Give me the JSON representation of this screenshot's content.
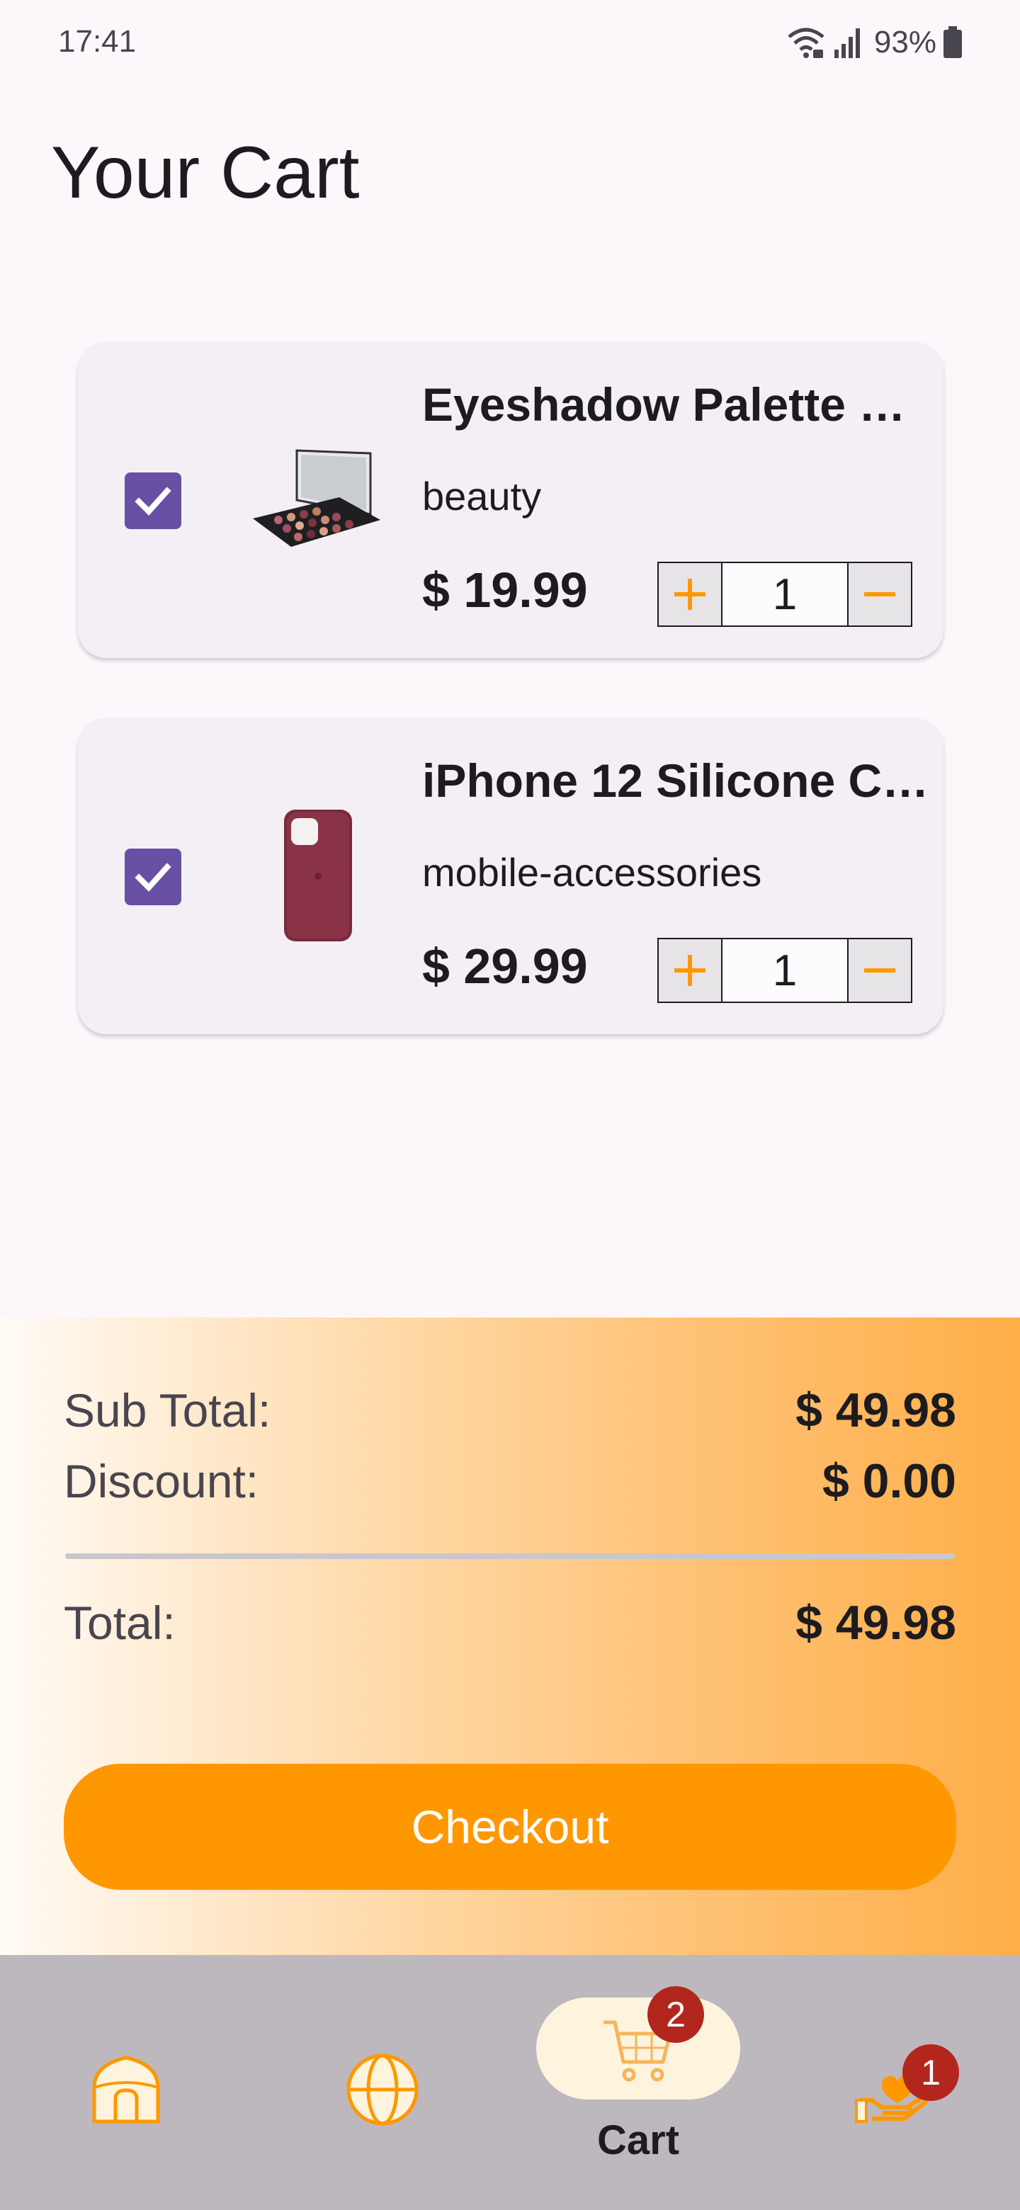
{
  "status": {
    "time": "17:41",
    "battery": "93%"
  },
  "title": "Your Cart",
  "cart_items": [
    {
      "name": "Eyeshadow Palette w…",
      "category": "beauty",
      "price": "$ 19.99",
      "qty": "1",
      "checked": true
    },
    {
      "name": "iPhone 12 Silicone C…",
      "category": "mobile-accessories",
      "price": "$ 29.99",
      "qty": "1",
      "checked": true
    }
  ],
  "summary": {
    "subtotal_label": "Sub Total:",
    "subtotal_value": "$ 49.98",
    "discount_label": "Discount:",
    "discount_value": "$ 0.00",
    "total_label": "Total:",
    "total_value": "$ 49.98",
    "checkout_label": "Checkout"
  },
  "nav": {
    "items": [
      "home-icon",
      "globe-icon",
      "cart-icon",
      "donate-hand-icon"
    ],
    "active_label": "Cart",
    "cart_badge": "2",
    "donate_badge": "1"
  },
  "colors": {
    "accent": "#ff9800",
    "checkbox": "#6750a4",
    "badge": "#b3261e"
  }
}
